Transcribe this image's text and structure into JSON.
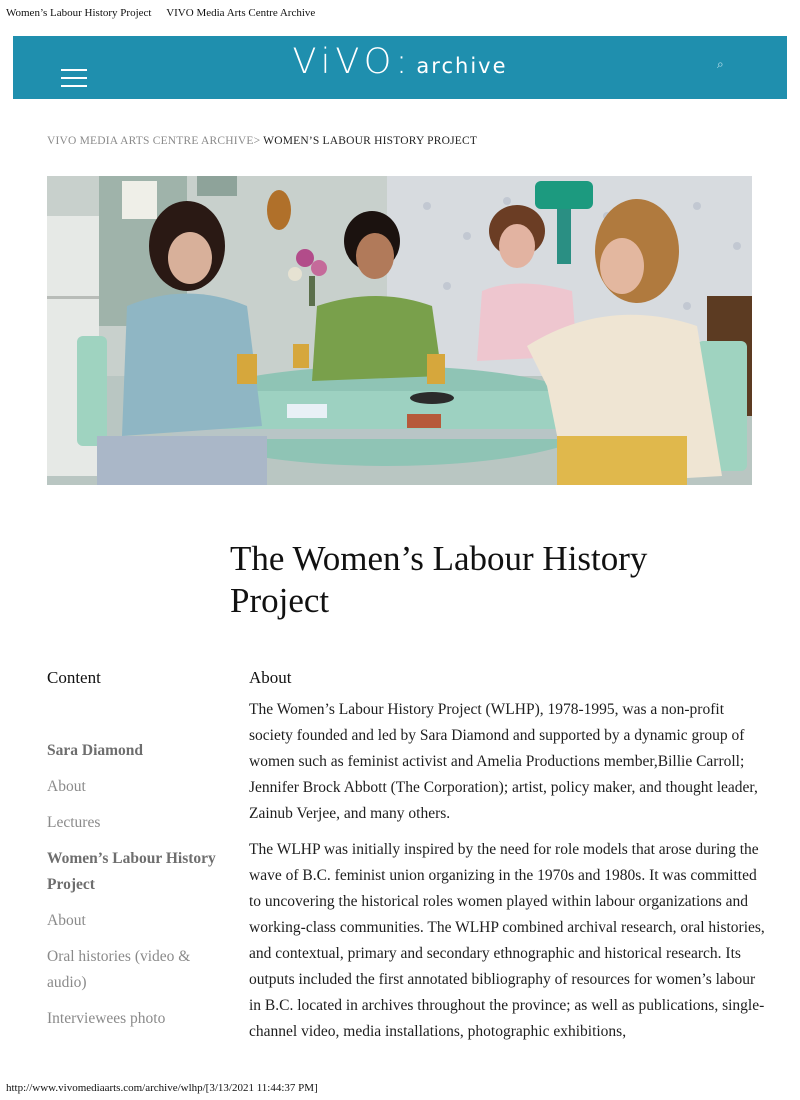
{
  "print_header": {
    "page_title": "Women’s Labour History Project",
    "site_title": "VIVO Media Arts Centre Archive"
  },
  "topbar": {
    "logo_main": "ViVO:",
    "logo_sub": "archive",
    "background_color": "#1f8fae",
    "menu_icon": "hamburger-icon",
    "search_icon": "search-icon"
  },
  "breadcrumb": {
    "root": "VIVO MEDIA ARTS CENTRE ARCHIVE",
    "separator": ">",
    "current": "WOMEN’S LABOUR HISTORY PROJECT"
  },
  "hero": {
    "description_icon": "photo"
  },
  "page": {
    "title": "The Women’s Labour History Project"
  },
  "sidebar": {
    "heading": "Content",
    "items": [
      {
        "label": "Sara Diamond",
        "bold": true
      },
      {
        "label": "About",
        "bold": false
      },
      {
        "label": "Lectures",
        "bold": false
      },
      {
        "label": "Women’s Labour History Project",
        "bold": true
      },
      {
        "label": "About",
        "bold": false
      },
      {
        "label": "Oral histories (video & audio)",
        "bold": false
      },
      {
        "label": "Interviewees photo",
        "bold": false
      }
    ]
  },
  "main": {
    "heading": "About",
    "paragraphs": [
      "The Women’s Labour History Project (WLHP), 1978-1995, was a non-profit society founded and led by Sara Diamond and supported by a dynamic group of women such as feminist activist and Amelia Productions member,Billie Carroll; Jennifer Brock Abbott (The Corporation); artist, policy maker, and thought leader, Zainub Verjee, and many others.",
      "The WLHP was initially inspired by the need for role models that arose during the wave of B.C. feminist union organizing in the 1970s and 1980s. It was committed to uncovering the historical roles women played within labour organizations and working-class communities. The WLHP combined archival research, oral histories, and contextual, primary and secondary ethnographic and historical research. Its outputs included the first annotated bibliography of resources for women’s labour in B.C. located in archives throughout the province; as well as publications, single-channel video, media installations, photographic exhibitions,"
    ]
  },
  "footer": {
    "url_line": "http://www.vivomediaarts.com/archive/wlhp/[3/13/2021 11:44:37 PM]"
  }
}
